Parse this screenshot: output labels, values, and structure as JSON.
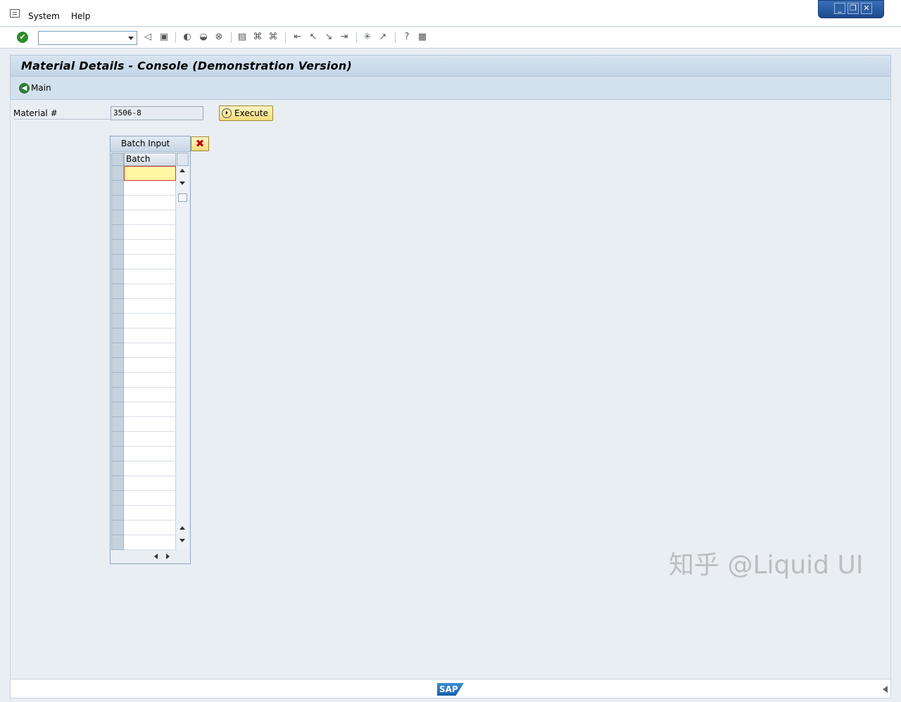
{
  "menu": {
    "items": [
      {
        "label": "System"
      },
      {
        "label": "Help"
      }
    ]
  },
  "toolbar": {
    "command_value": ""
  },
  "screen": {
    "title": "Material Details - Console (Demonstration Version)",
    "main_button_label": "Main"
  },
  "form": {
    "material_label": "Material #",
    "material_value": "3506-8",
    "execute_label": "Execute"
  },
  "batch_table": {
    "title": "Batch Input",
    "column_header": "Batch",
    "row_count": 26,
    "rows": [
      "",
      "",
      "",
      "",
      "",
      "",
      "",
      "",
      "",
      "",
      "",
      "",
      "",
      "",
      "",
      "",
      "",
      "",
      "",
      "",
      "",
      "",
      "",
      "",
      "",
      ""
    ]
  },
  "watermark": "知乎 @Liquid UI",
  "statusbar": {
    "logo_text": "SAP"
  },
  "colors": {
    "title_bg": "#c3d5e6",
    "button_yellow": "#f4dc7a",
    "active_cell": "#fff7a3"
  }
}
